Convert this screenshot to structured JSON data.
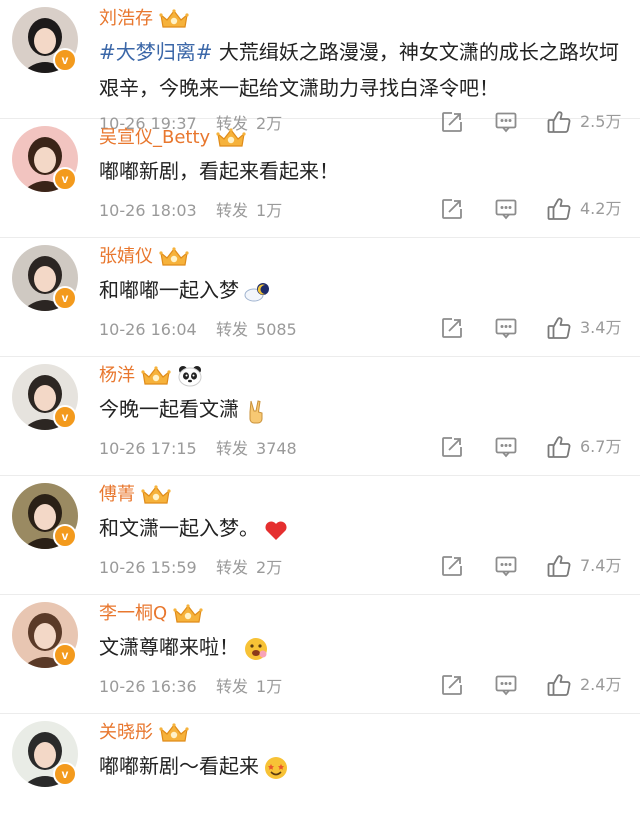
{
  "labels": {
    "repost": "转发"
  },
  "posts": [
    {
      "name": "刘浩存",
      "hashtag": "#大梦归离#",
      "text": " 大荒缉妖之路漫漫，神女文潇的成长之路坎坷艰辛，今晚来一起给文潇助力寻找白泽令吧！",
      "time": "10-26 19:37",
      "reposts": "2万",
      "likes": "2.5万",
      "avatar_bg": "#d9cfc8",
      "emoji": ""
    },
    {
      "name": "吴宣仪_Betty",
      "hashtag": "",
      "text": "嘟嘟新剧，看起来看起来！",
      "time": "10-26 18:03",
      "reposts": "1万",
      "likes": "4.2万",
      "avatar_bg": "#f2c4c0",
      "emoji": ""
    },
    {
      "name": "张婧仪",
      "hashtag": "",
      "text": "和嘟嘟一起入梦",
      "time": "10-26 16:04",
      "reposts": "5085",
      "likes": "3.4万",
      "avatar_bg": "#cfc9c2",
      "emoji": "cloud-and-moon"
    },
    {
      "name": "杨洋",
      "hashtag": "",
      "text": "今晚一起看文潇",
      "time": "10-26 17:15",
      "reposts": "3748",
      "likes": "6.7万",
      "avatar_bg": "#e6e3de",
      "emoji": "victory-hand"
    },
    {
      "name": "傅菁",
      "hashtag": "",
      "text": "和文潇一起入梦。",
      "time": "10-26 15:59",
      "reposts": "2万",
      "likes": "7.4万",
      "avatar_bg": "#9a8a62",
      "emoji": "heart"
    },
    {
      "name": "李一桐Q",
      "hashtag": "",
      "text": "文潇尊嘟来啦！",
      "time": "10-26 16:36",
      "reposts": "1万",
      "likes": "2.4万",
      "avatar_bg": "#e8c6b2",
      "emoji": "excited-face"
    },
    {
      "name": "关晓彤",
      "hashtag": "",
      "text": "嘟嘟新剧～看起来",
      "time": "",
      "reposts": "",
      "likes": "",
      "avatar_bg": "#e9ece6",
      "emoji": "star-eyes-face"
    }
  ],
  "colors": {
    "username": "#e8772e",
    "hashtag": "#3b67a8",
    "meta": "#9a9a9a",
    "verified": "#f39a1d"
  },
  "icons": {
    "share": "share-icon",
    "comment": "comment-icon",
    "like": "thumbs-up-icon",
    "crown": "crown-badge-icon",
    "verified": "verified-badge-icon",
    "panda": "panda-icon"
  }
}
